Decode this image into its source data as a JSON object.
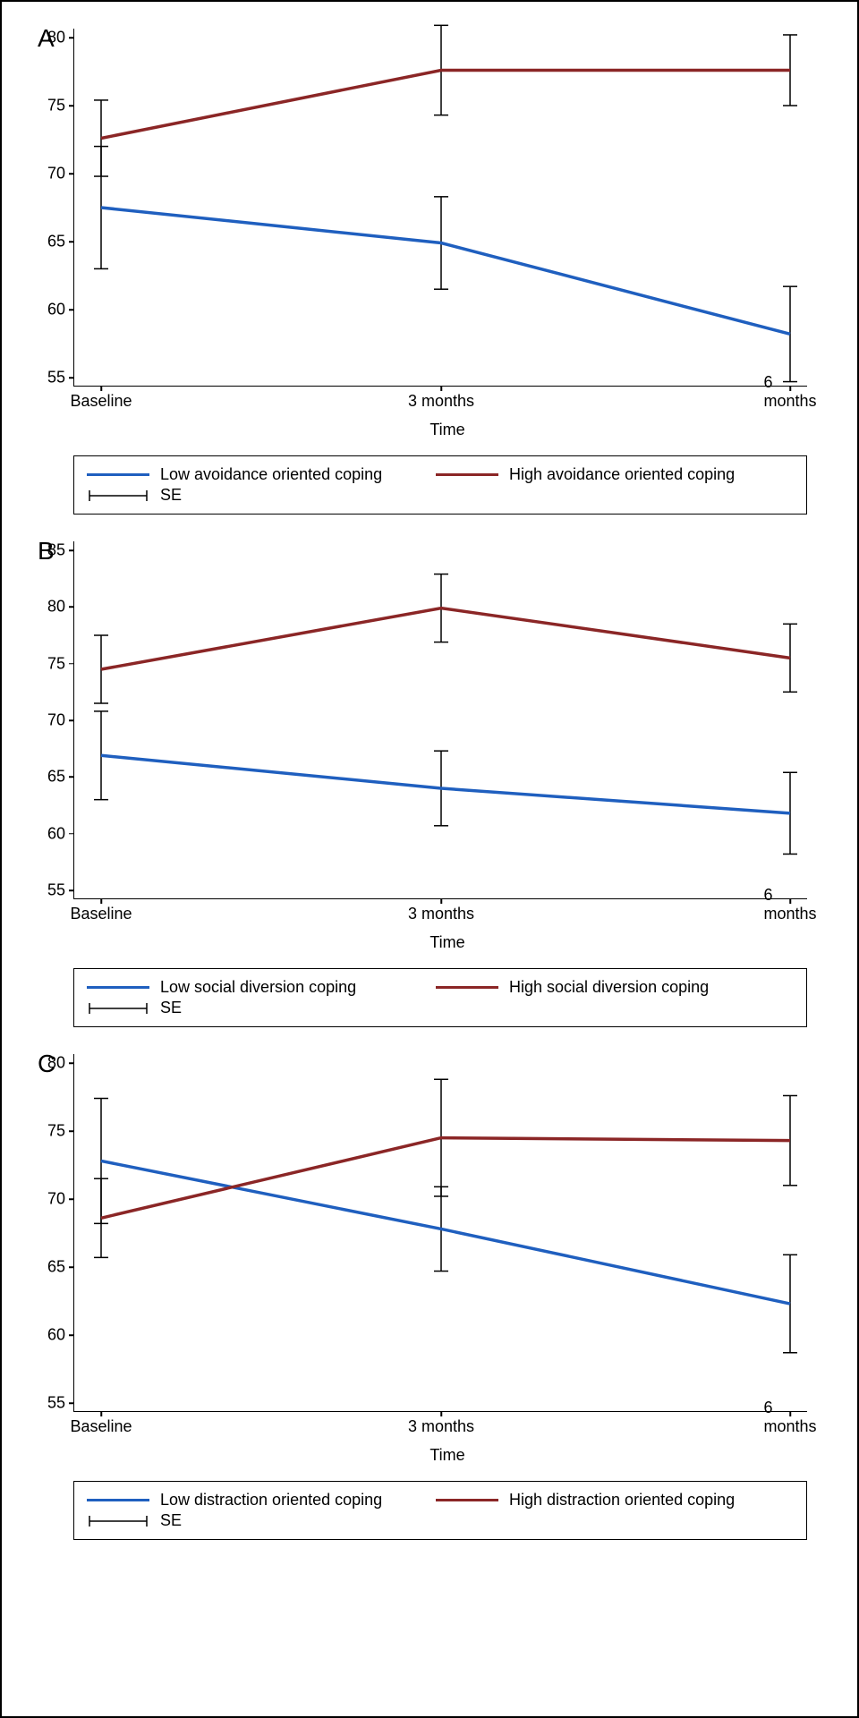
{
  "colors": {
    "low": "#1f5fbf",
    "high": "#8b2626",
    "error": "#000000"
  },
  "xlabel": "Time",
  "x_categories": [
    "Baseline",
    "3 months",
    "6 months"
  ],
  "legend_se": "SE",
  "chart_data": [
    {
      "panel": "A",
      "type": "line",
      "xlabel": "Time",
      "ylabel": "",
      "ylim": [
        55,
        80
      ],
      "y_ticks": [
        55,
        60,
        65,
        70,
        75,
        80
      ],
      "categories": [
        "Baseline",
        "3 months",
        "6 months"
      ],
      "series": [
        {
          "name": "Low avoidance oriented coping",
          "color": "#1f5fbf",
          "values": [
            67.5,
            64.9,
            58.2
          ],
          "se": [
            4.5,
            3.4,
            3.5
          ]
        },
        {
          "name": "High avoidance oriented coping",
          "color": "#8b2626",
          "values": [
            72.6,
            77.6,
            77.6
          ],
          "se": [
            2.8,
            3.3,
            2.6
          ]
        }
      ],
      "legend": [
        "Low avoidance oriented coping",
        "High avoidance oriented coping",
        "SE"
      ]
    },
    {
      "panel": "B",
      "type": "line",
      "xlabel": "Time",
      "ylabel": "",
      "ylim": [
        55,
        85
      ],
      "y_ticks": [
        55,
        60,
        65,
        70,
        75,
        80,
        85
      ],
      "categories": [
        "Baseline",
        "3 months",
        "6 months"
      ],
      "series": [
        {
          "name": "Low social diversion coping",
          "color": "#1f5fbf",
          "values": [
            66.9,
            64.0,
            61.8
          ],
          "se": [
            3.9,
            3.3,
            3.6
          ]
        },
        {
          "name": "High social diversion coping",
          "color": "#8b2626",
          "values": [
            74.5,
            79.9,
            75.5
          ],
          "se": [
            3.0,
            3.0,
            3.0
          ]
        }
      ],
      "legend": [
        "Low social diversion coping",
        "High social diversion coping",
        "SE"
      ]
    },
    {
      "panel": "C",
      "type": "line",
      "xlabel": "Time",
      "ylabel": "",
      "ylim": [
        55,
        80
      ],
      "y_ticks": [
        55,
        60,
        65,
        70,
        75,
        80
      ],
      "categories": [
        "Baseline",
        "3 months",
        "6 months"
      ],
      "series": [
        {
          "name": "Low distraction oriented coping",
          "color": "#1f5fbf",
          "values": [
            72.8,
            67.8,
            62.3
          ],
          "se": [
            4.6,
            3.1,
            3.6
          ]
        },
        {
          "name": "High distraction oriented coping",
          "color": "#8b2626",
          "values": [
            68.6,
            74.5,
            74.3
          ],
          "se": [
            2.9,
            4.3,
            3.3
          ]
        }
      ],
      "legend": [
        "Low distraction oriented coping",
        "High distraction oriented coping",
        "SE"
      ]
    }
  ]
}
